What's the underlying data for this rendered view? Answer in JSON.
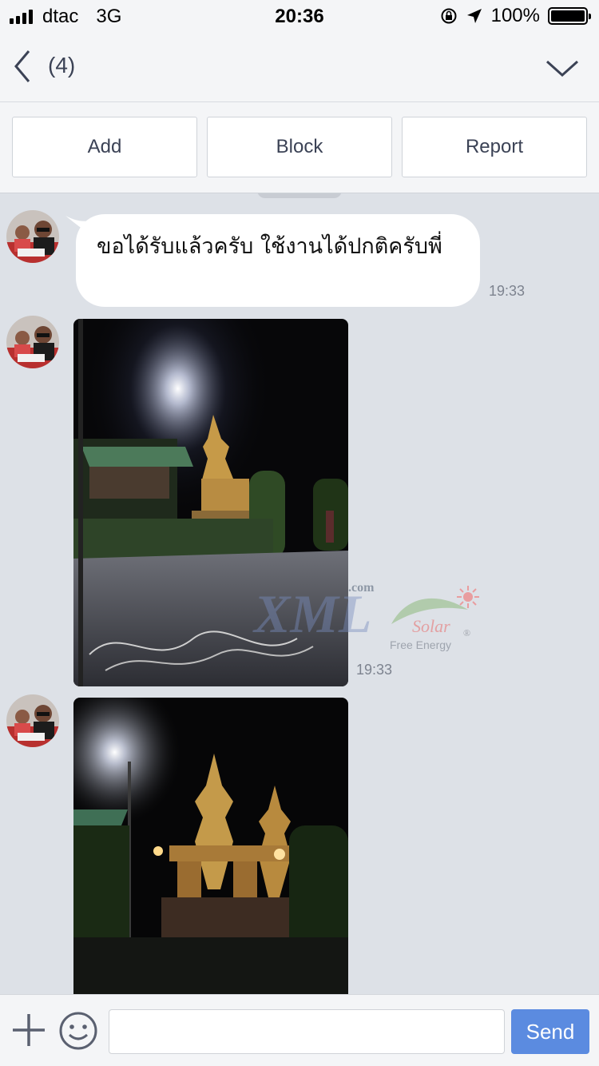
{
  "status_bar": {
    "carrier": "dtac",
    "network": "3G",
    "time": "20:36",
    "battery_text": "100%",
    "icons": [
      "signal-icon",
      "rotation-lock-icon",
      "location-arrow-icon",
      "battery-icon"
    ]
  },
  "header": {
    "title": "(4)",
    "icons": [
      "back-chevron-icon",
      "chevron-down-icon"
    ]
  },
  "actions": {
    "add_label": "Add",
    "block_label": "Block",
    "report_label": "Report"
  },
  "messages": [
    {
      "type": "text",
      "text": "ขอได้รับแล้วครับ ใช้งานได้ปกติครับพี่",
      "time": "19:33"
    },
    {
      "type": "photo",
      "time": "19:33",
      "image_subject": "solar street light illuminating a spirit house and gravel yard at night"
    },
    {
      "type": "photo",
      "time": "",
      "image_subject": "golden spirit house lit by a solar lamp at night"
    }
  ],
  "watermark": {
    "domain_suffix": ".com",
    "brand": "XML",
    "solar_word": "Solar",
    "tagline": "Free Energy",
    "registered": "®"
  },
  "input_bar": {
    "placeholder": "",
    "value": "",
    "send_label": "Send",
    "icons": [
      "plus-icon",
      "emoji-icon"
    ]
  },
  "colors": {
    "chat_background": "#dde1e7",
    "bar_background": "#f4f5f7",
    "send_button": "#5b8be0",
    "text_primary": "#3b4255",
    "timestamp": "#7d838f"
  }
}
